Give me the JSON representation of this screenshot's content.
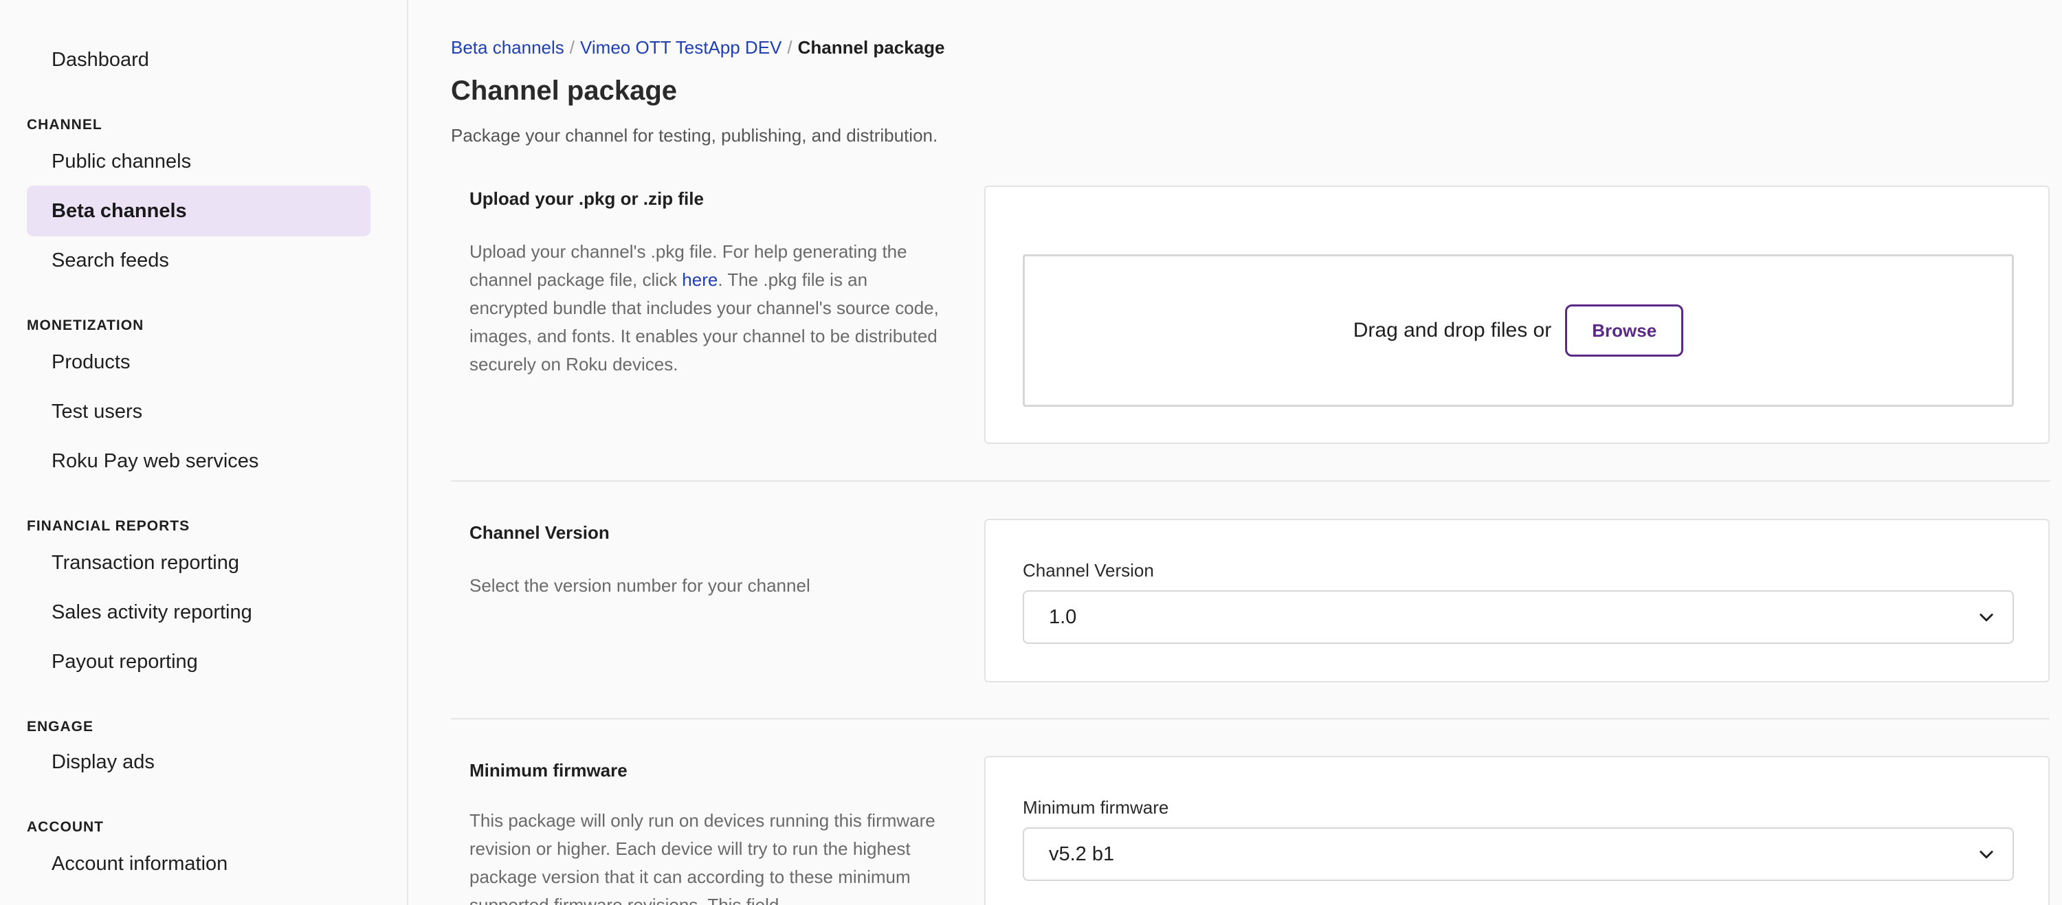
{
  "sidebar": {
    "dashboard": "Dashboard",
    "sections": [
      {
        "heading": "CHANNEL",
        "items": [
          "Public channels",
          "Beta channels",
          "Search feeds"
        ]
      },
      {
        "heading": "MONETIZATION",
        "items": [
          "Products",
          "Test users",
          "Roku Pay web services"
        ]
      },
      {
        "heading": "FINANCIAL REPORTS",
        "items": [
          "Transaction reporting",
          "Sales activity reporting",
          "Payout reporting"
        ]
      },
      {
        "heading": "ENGAGE",
        "items": [
          "Display ads"
        ]
      },
      {
        "heading": "ACCOUNT",
        "items": [
          "Account information"
        ]
      }
    ],
    "active_item": "Beta channels"
  },
  "breadcrumb": {
    "level1": "Beta channels",
    "level2": "Vimeo OTT TestApp DEV",
    "current": "Channel package",
    "separator": "/"
  },
  "page": {
    "title": "Channel package",
    "subtitle": "Package your channel for testing, publishing, and distribution."
  },
  "upload": {
    "title": "Upload your .pkg or .zip file",
    "desc_before": "Upload your channel's .pkg file. For help generating the channel package file, click ",
    "desc_link": "here",
    "desc_after": ". The .pkg file is an encrypted bundle that includes your channel's source code, images, and fonts. It enables your channel to be distributed securely on Roku devices.",
    "drop_text": "Drag and drop files or",
    "browse_label": "Browse"
  },
  "version": {
    "title": "Channel Version",
    "desc": "Select the version number for your channel",
    "field_label": "Channel Version",
    "selected": "1.0"
  },
  "firmware": {
    "title": "Minimum firmware",
    "desc": "This package will only run on devices running this firmware revision or higher. Each device will try to run the highest package version that it can according to these minimum supported firmware revisions. This field",
    "field_label": "Minimum firmware",
    "selected": "v5.2 b1"
  },
  "colors": {
    "accent": "#5b2a86",
    "active_bg": "#ebe2f6",
    "link": "#1f3fb3"
  }
}
